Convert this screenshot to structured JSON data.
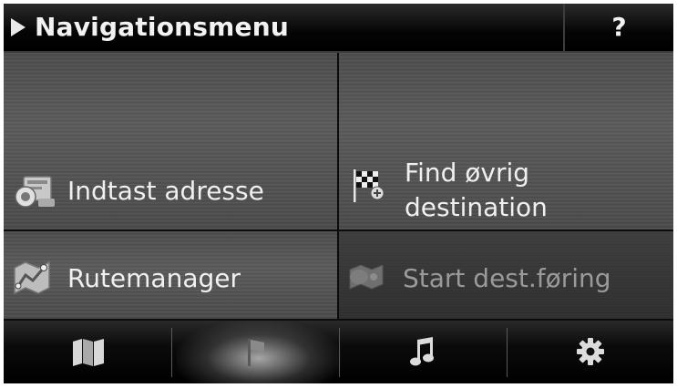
{
  "header": {
    "title": "Navigationsmenu",
    "help_label": "?"
  },
  "tiles": [
    {
      "label": "Indtast adresse",
      "icon": "address-book-icon",
      "enabled": true
    },
    {
      "label_line1": "Find øvrig",
      "label_line2": "destination",
      "icon": "checkered-flag-icon",
      "enabled": true
    },
    {
      "label": "Rutemanager",
      "icon": "route-map-icon",
      "enabled": true
    },
    {
      "label": "Start dest.føring",
      "icon": "route-start-icon",
      "enabled": false
    }
  ],
  "bottom_nav": [
    {
      "icon": "map-icon",
      "active": false
    },
    {
      "icon": "flag-icon",
      "active": true
    },
    {
      "icon": "music-note-icon",
      "active": false
    },
    {
      "icon": "gear-icon",
      "active": false
    }
  ]
}
